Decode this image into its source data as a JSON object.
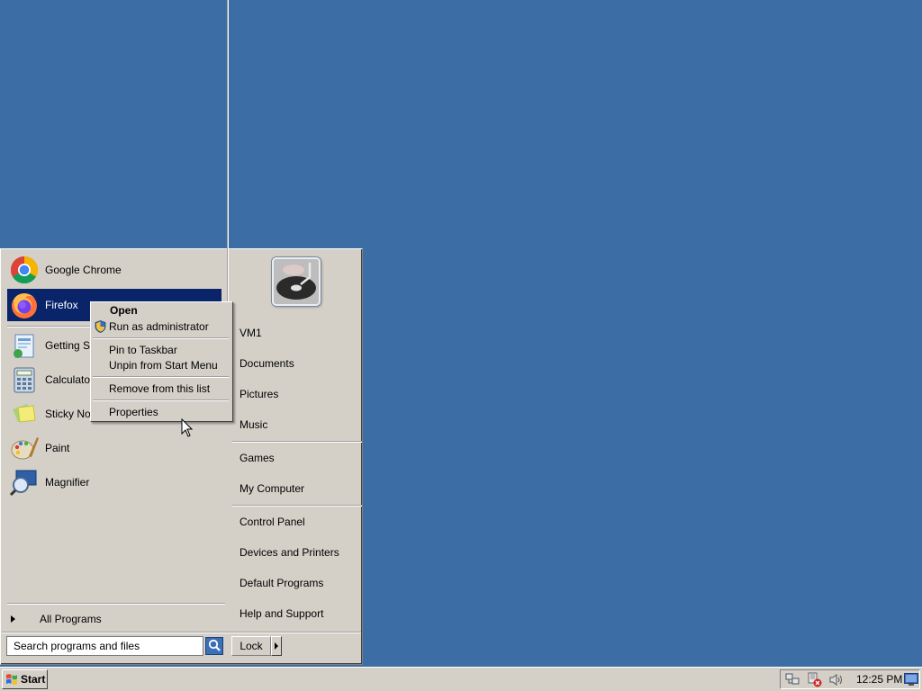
{
  "start_menu": {
    "pinned_programs": [
      {
        "label": "Google Chrome",
        "icon": "chrome-icon"
      },
      {
        "label": "Firefox",
        "icon": "firefox-icon"
      }
    ],
    "recent_programs": [
      {
        "label": "Getting Started",
        "icon": "getting-started-icon"
      },
      {
        "label": "Calculator",
        "icon": "calculator-icon"
      },
      {
        "label": "Sticky Notes",
        "icon": "sticky-notes-icon"
      },
      {
        "label": "Paint",
        "icon": "paint-icon"
      },
      {
        "label": "Magnifier",
        "icon": "magnifier-icon"
      }
    ],
    "all_programs_label": "All Programs",
    "search_placeholder": "Search programs and files",
    "lock_label": "Lock",
    "right_items": [
      "VM1",
      "Documents",
      "Pictures",
      "Music",
      "Games",
      "My Computer",
      "Control Panel",
      "Devices and Printers",
      "Default Programs",
      "Help and Support"
    ]
  },
  "context_menu": {
    "items": [
      "Open",
      "Run as administrator",
      "Pin to Taskbar",
      "Unpin from Start Menu",
      "Remove from this list",
      "Properties"
    ]
  },
  "taskbar": {
    "start_label": "Start",
    "clock": "12:25 PM"
  },
  "colors": {
    "desktop": "#3c6ea5",
    "selection": "#0a246a",
    "face": "#d4d0c8"
  }
}
